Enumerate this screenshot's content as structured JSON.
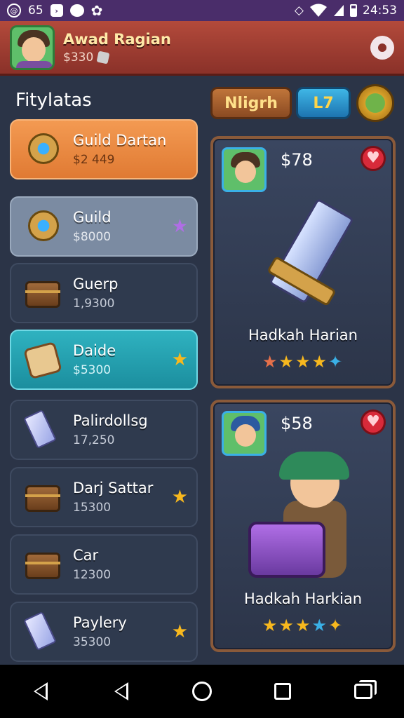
{
  "status_bar": {
    "notification_count": "65",
    "time": "24:53"
  },
  "header": {
    "player_name": "Awad Ragian",
    "player_coins": "$330"
  },
  "section": {
    "title": "Fitylatas"
  },
  "chips": {
    "night": "Nligrh",
    "level": "L7"
  },
  "list": [
    {
      "title": "Guild Dartan",
      "sub": "$2 449",
      "star": ""
    },
    {
      "title": "Guild",
      "sub": "$8000",
      "star": "★"
    },
    {
      "title": "Guerp",
      "sub": "1,9300",
      "star": ""
    },
    {
      "title": "Daide",
      "sub": "$5300",
      "star": "★"
    },
    {
      "title": "Palirdollsg",
      "sub": "17,250",
      "star": ""
    },
    {
      "title": "Darj Sattar",
      "sub": "15300",
      "star": "★"
    },
    {
      "title": "Car",
      "sub": "12300",
      "star": ""
    },
    {
      "title": "Paylery",
      "sub": "35300",
      "star": "★"
    }
  ],
  "cards": [
    {
      "price": "$78",
      "name": "Hadkah Harian",
      "rating": 4
    },
    {
      "price": "$58",
      "name": "Hadkah Harkian",
      "rating": 4
    }
  ]
}
